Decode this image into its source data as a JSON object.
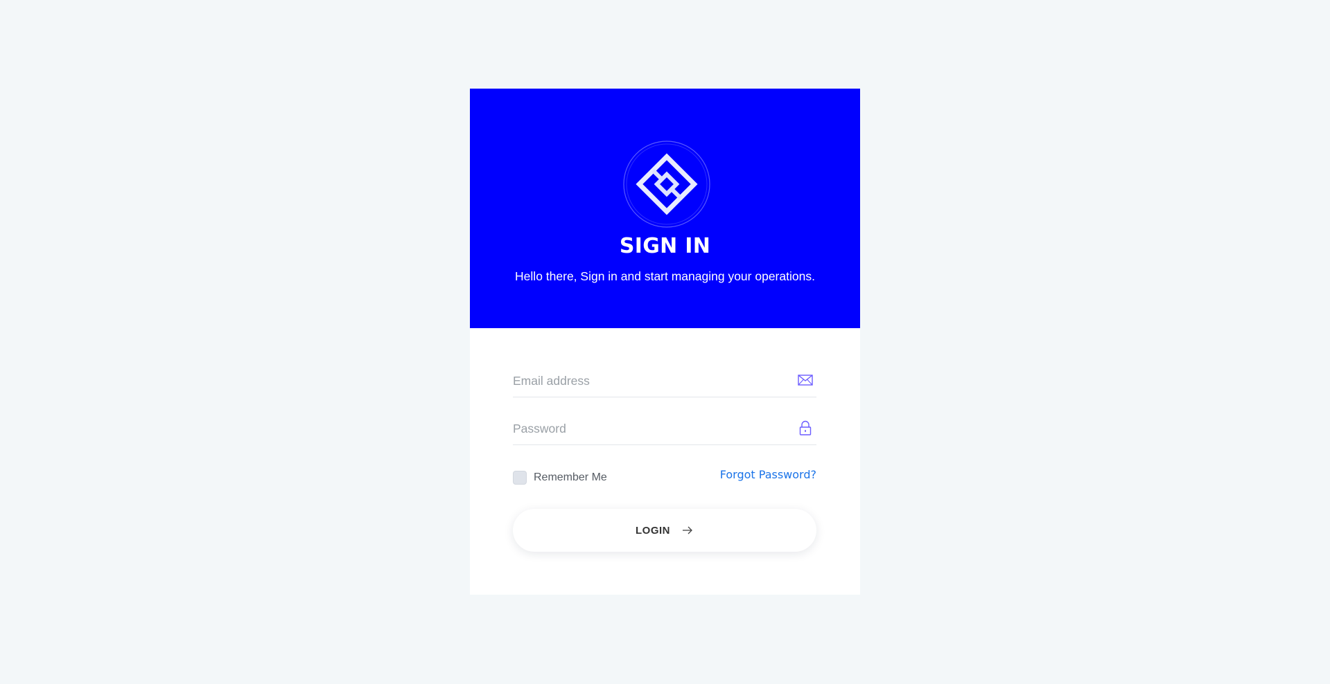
{
  "hero": {
    "title": "SIGN IN",
    "subtitle": "Hello there, Sign in and start managing your operations.",
    "background": "#0000fe",
    "logo_icon": "diamond-logo-icon"
  },
  "form": {
    "email": {
      "placeholder": "Email address",
      "value": "",
      "icon": "envelope-icon"
    },
    "password": {
      "placeholder": "Password",
      "value": "",
      "icon": "lock-icon"
    },
    "remember_label": "Remember Me",
    "remember_checked": false,
    "forgot_label": "Forgot Password?",
    "login_label": "LOGIN",
    "login_icon": "arrow-right-icon"
  },
  "colors": {
    "page_background": "#f3f7f9",
    "accent": "#0000fe",
    "link": "#1a73e8",
    "icon": "#6b5cff"
  }
}
